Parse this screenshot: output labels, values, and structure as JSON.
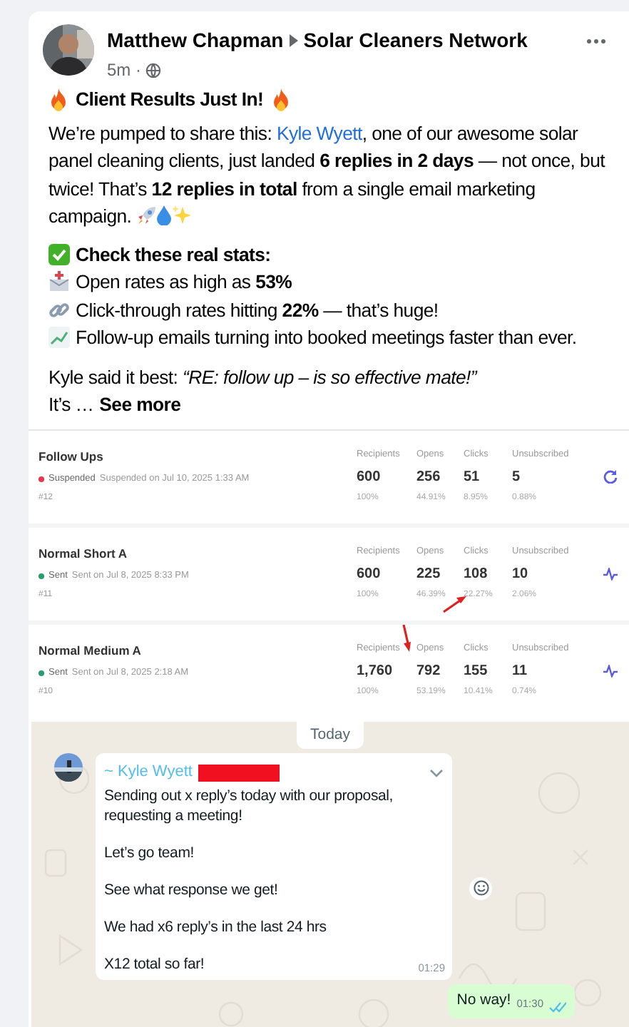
{
  "post": {
    "author": "Matthew Chapman",
    "group": "Solar Cleaners Network",
    "time": "5m ·",
    "title": "Client Results Just In!",
    "intro": {
      "before": "We’re pumped to share this: ",
      "link": "Kyle Wyett",
      "after": ", one of our awesome solar panel cleaning clients, just landed **6 replies in 2 days** — not once, but twice! That’s **12 replies in total** from a single email marketing campaign."
    },
    "stats_heading": "Check these real stats:",
    "stats": [
      {
        "kind": "mail",
        "text": "Open rates as high as **53%**"
      },
      {
        "kind": "link",
        "text": "Click-through rates hitting **22%** — that’s huge!"
      },
      {
        "kind": "chart",
        "text": "Follow-up emails turning into booked meetings faster than ever."
      }
    ],
    "quote": "Kyle said it best: *“RE: follow up – is so effective mate!”*",
    "more": {
      "prefix": "It’s …",
      "link": "See more"
    }
  },
  "campaigns": [
    {
      "name": "Follow Ups",
      "status": "Suspended",
      "color": "#e8364f",
      "date": "Suspended on Jul 10, 2025 1:33 AM",
      "number": "#12",
      "kind": "refresh",
      "stats": [
        {
          "label": "Recipients",
          "value": "600",
          "percent": "100%"
        },
        {
          "label": "Opens",
          "value": "256",
          "percent": "44.91%"
        },
        {
          "label": "Clicks",
          "value": "51",
          "percent": "8.95%"
        },
        {
          "label": "Unsubscribed",
          "value": "5",
          "percent": "0.88%"
        }
      ]
    },
    {
      "name": "Normal Short A",
      "status": "Sent",
      "color": "#22a06b",
      "date": "Sent on Jul 8, 2025 8:33 PM",
      "number": "#11",
      "kind": "activity",
      "stats": [
        {
          "label": "Recipients",
          "value": "600",
          "percent": "100%"
        },
        {
          "label": "Opens",
          "value": "225",
          "percent": "46.39%"
        },
        {
          "label": "Clicks",
          "value": "108",
          "percent": "22.27%"
        },
        {
          "label": "Unsubscribed",
          "value": "10",
          "percent": "2.06%"
        }
      ]
    },
    {
      "name": "Normal Medium A",
      "status": "Sent",
      "color": "#22a06b",
      "date": "Sent on Jul 8, 2025 2:18 AM",
      "number": "#10",
      "kind": "activity",
      "stats": [
        {
          "label": "Recipients",
          "value": "1,760",
          "percent": "100%"
        },
        {
          "label": "Opens",
          "value": "792",
          "percent": "53.19%"
        },
        {
          "label": "Clicks",
          "value": "155",
          "percent": "10.41%"
        },
        {
          "label": "Unsubscribed",
          "value": "11",
          "percent": "0.74%"
        }
      ]
    }
  ],
  "chat": {
    "day": "Today",
    "message": {
      "sender": "~ Kyle Wyett",
      "paragraphs": [
        "Sending out x reply’s today with our proposal, requesting a meeting!",
        "Let’s go team!",
        "See what response we get!",
        "We had x6 reply’s in the last 24 hrs",
        "X12 total so far!"
      ],
      "time": "01:29"
    },
    "reply": {
      "text": "No way!",
      "time": "01:30",
      "read": true
    }
  }
}
